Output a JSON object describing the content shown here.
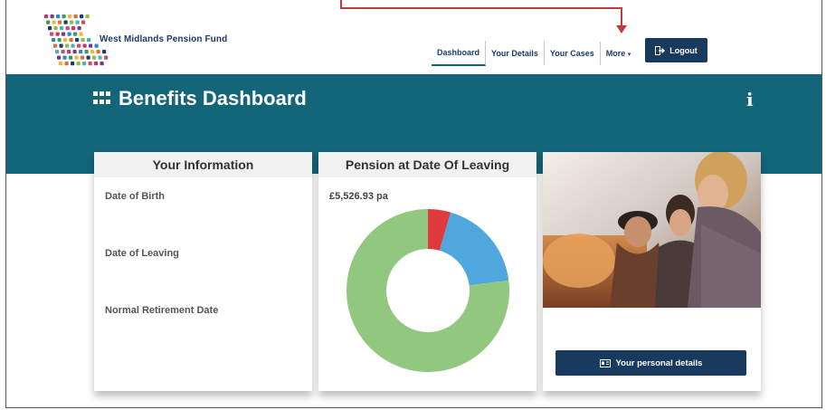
{
  "brand": {
    "name": "West Midlands Pension Fund"
  },
  "nav": {
    "items": [
      {
        "label": "Dashboard",
        "active": true
      },
      {
        "label": "Your Details",
        "active": false
      },
      {
        "label": "Your Cases",
        "active": false
      },
      {
        "label": "More",
        "active": false
      }
    ],
    "logout_label": "Logout"
  },
  "header": {
    "title": "Benefits Dashboard",
    "info_symbol": "i"
  },
  "your_information": {
    "title": "Your Information",
    "fields": [
      "Date of Birth",
      "Date of Leaving",
      "Normal Retirement Date"
    ]
  },
  "pension_card": {
    "title": "Pension at Date Of Leaving",
    "value": "£5,526.93 pa",
    "segments": [
      {
        "share": 0.045,
        "color": "#e0393e"
      },
      {
        "share": 0.185,
        "color": "#4fa7de"
      },
      {
        "share": 0.77,
        "color": "#92c77f"
      }
    ]
  },
  "personal_card": {
    "button_label": "Your personal details"
  },
  "colors": {
    "band": "#136579",
    "button": "#173a5e",
    "annotation": "#c23b3b"
  }
}
